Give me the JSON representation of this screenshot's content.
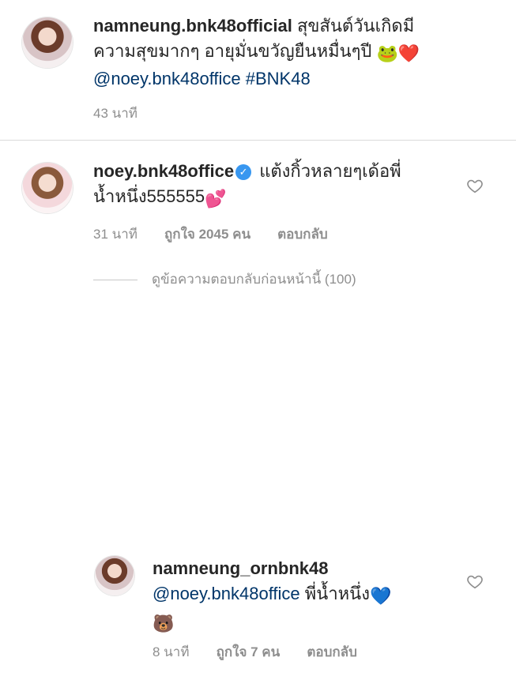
{
  "caption": {
    "username": "namneung.bnk48official",
    "text_line1": "สุขสันต์วันเกิดมี",
    "text_line2": "ความสุขมากๆ อายุมั่นขวัญยืนหมื่นๆปี",
    "emoji_frog": "🐸",
    "emoji_heart": "❤️",
    "mention": "@noey.bnk48office #BNK48",
    "time": "43 นาที"
  },
  "comment1": {
    "username": "noey.bnk48office",
    "verified_mark": "✓",
    "text_line1": "แต้งกิ้วหลายๆเด้อพี่",
    "text_line2": "น้ำหนึ่ง555555",
    "emoji_hearts": "💕",
    "time": "31 นาที",
    "likes": "ถูกใจ 2045 คน",
    "reply": "ตอบกลับ"
  },
  "view_replies": {
    "label": "ดูข้อความตอบกลับก่อนหน้านี้ (100)"
  },
  "reply1": {
    "username": "namneung_ornbnk48",
    "mention": "@noey.bnk48office",
    "text": "พี่น้ำหนึ่ง",
    "emoji_heart": "💙",
    "emoji_bear": "🐻",
    "time": "8 นาที",
    "likes": "ถูกใจ 7 คน",
    "reply": "ตอบกลับ"
  },
  "icons": {
    "like": "heart-outline-icon",
    "verified": "verified-badge-icon"
  },
  "colors": {
    "text": "#262626",
    "meta": "#8e8e8e",
    "mention": "#003569",
    "verified": "#3897f0",
    "heart_red": "#ed4956"
  }
}
